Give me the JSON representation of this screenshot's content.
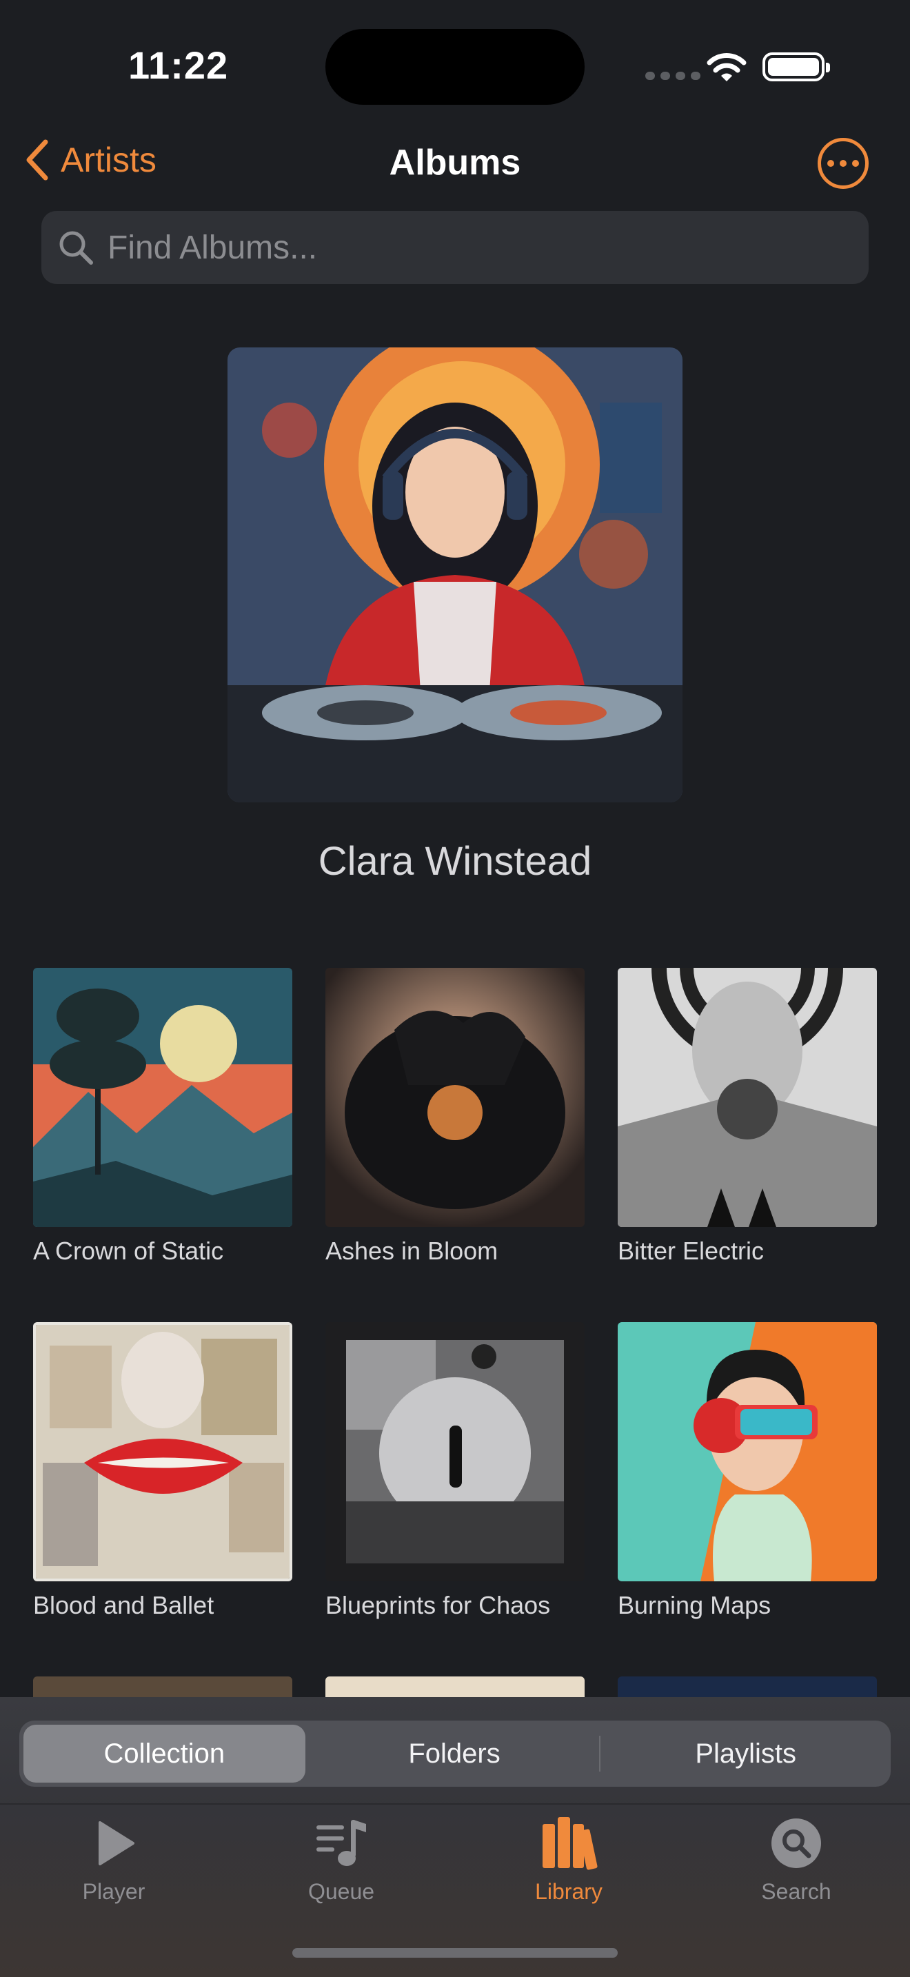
{
  "status": {
    "time": "11:22"
  },
  "nav": {
    "back_label": "Artists",
    "title": "Albums"
  },
  "search": {
    "placeholder": "Find Albums..."
  },
  "artist": {
    "name": "Clara Winstead"
  },
  "albums": [
    {
      "title": "A Crown of Static"
    },
    {
      "title": "Ashes in Bloom"
    },
    {
      "title": "Bitter Electric"
    },
    {
      "title": "Blood and Ballet"
    },
    {
      "title": "Blueprints for Chaos"
    },
    {
      "title": "Burning Maps"
    }
  ],
  "segments": [
    "Collection",
    "Folders",
    "Playlists"
  ],
  "tabs": [
    {
      "label": "Player",
      "icon": "play-icon"
    },
    {
      "label": "Queue",
      "icon": "queue-icon"
    },
    {
      "label": "Library",
      "icon": "library-icon"
    },
    {
      "label": "Search",
      "icon": "search-icon"
    }
  ],
  "colors": {
    "accent": "#f08a3c",
    "background": "#1c1e22"
  }
}
